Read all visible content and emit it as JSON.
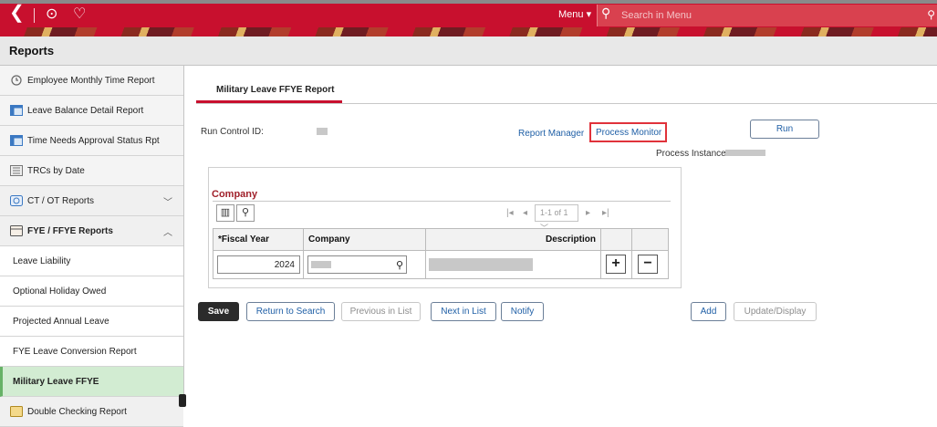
{
  "topbar": {
    "menu_label": "Menu",
    "menu_caret": "▾",
    "search_placeholder": "Search in Menu"
  },
  "reports_header": {
    "title": "Reports"
  },
  "sidebar": {
    "items": [
      {
        "label": "Employee Monthly Time Report"
      },
      {
        "label": "Leave Balance Detail Report"
      },
      {
        "label": "Time Needs Approval Status Rpt"
      },
      {
        "label": "TRCs by Date"
      },
      {
        "label": "CT / OT Reports"
      },
      {
        "label": "FYE / FFYE Reports"
      },
      {
        "label": "Leave Liability"
      },
      {
        "label": "Optional Holiday Owed"
      },
      {
        "label": "Projected Annual Leave"
      },
      {
        "label": "FYE Leave Conversion Report"
      },
      {
        "label": "Military Leave FFYE"
      },
      {
        "label": "Double Checking Report"
      }
    ]
  },
  "main": {
    "tab_label": "Military Leave FFYE Report",
    "run_control_label": "Run Control ID:",
    "report_manager": "Report Manager",
    "process_monitor": "Process Monitor",
    "run_button": "Run",
    "process_instance_label": "Process Instance:",
    "company_section": {
      "title": "Company",
      "pager": "1-1 of 1",
      "columns": {
        "fiscal_year": "*Fiscal Year",
        "company": "Company",
        "description": "Description"
      },
      "row": {
        "fiscal_year": "2024"
      }
    },
    "buttons": {
      "save": "Save",
      "return_to_search": "Return to Search",
      "previous_in_list": "Previous in List",
      "next_in_list": "Next in List",
      "notify": "Notify",
      "add": "Add",
      "update_display": "Update/Display"
    }
  }
}
